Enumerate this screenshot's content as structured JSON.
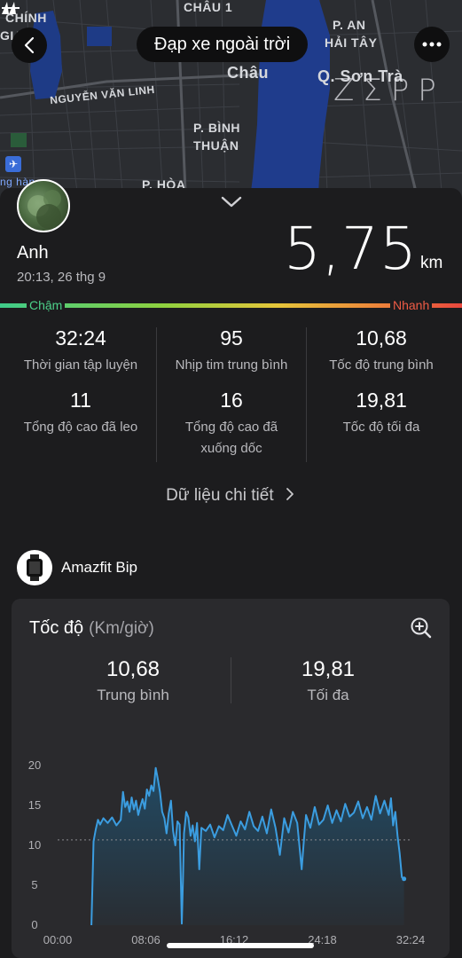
{
  "map": {
    "labels": {
      "chinh": "CHÍNH",
      "gia": "GIA",
      "chau1": "CHÂU 1",
      "p_an": "P. AN",
      "hai_tay": "HẢI TÂY",
      "chau": "Châu",
      "son_tra": "Q. Sơn Trà",
      "nguyen_van_linh": "NGUYỄN VĂN LINH",
      "p_binh": "P. BÌNH",
      "thuan": "THUẬN",
      "p_hoa": "P. HÒA",
      "ng_han": "ng hàn"
    },
    "watermark": "ZΣPP"
  },
  "header": {
    "title": "Đạp xe ngoài trời",
    "back_icon": "chevron-left-icon",
    "more_icon": "more-dots-icon"
  },
  "workout": {
    "user_name": "Anh",
    "datetime": "20:13, 26 thg 9",
    "distance": "5,75",
    "distance_unit": "km",
    "slow_label": "Chậm",
    "fast_label": "Nhanh"
  },
  "stats": [
    {
      "value": "32:24",
      "label": "Thời gian tập luyện"
    },
    {
      "value": "95",
      "label": "Nhịp tim trung bình"
    },
    {
      "value": "10,68",
      "label": "Tốc độ trung bình"
    },
    {
      "value": "11",
      "label": "Tổng độ cao đã leo"
    },
    {
      "value": "16",
      "label": "Tổng độ cao đã xuống dốc"
    },
    {
      "value": "19,81",
      "label": "Tốc độ tối đa"
    }
  ],
  "detail_link": "Dữ liệu chi tiết",
  "device": {
    "name": "Amazfit Bip"
  },
  "speed_card": {
    "title": "Tốc độ",
    "unit": "(Km/giờ)",
    "avg_value": "10,68",
    "avg_label": "Trung bình",
    "max_value": "19,81",
    "max_label": "Tối đa"
  },
  "colors": {
    "line": "#3b9de0",
    "fill_top": "#1f5576",
    "avg_line": "#8a8a8e"
  },
  "chart_data": {
    "type": "area",
    "title": "",
    "xlabel": "",
    "ylabel": "",
    "ylim": [
      0,
      20
    ],
    "yticks": [
      "0",
      "5",
      "10",
      "15",
      "20"
    ],
    "xticks": [
      "00:00",
      "08:06",
      "16:12",
      "24:18",
      "32:24"
    ],
    "average": 10.68,
    "series": [
      {
        "x_min": [
          3.1,
          3.3,
          3.5,
          3.7,
          3.9,
          4.2,
          4.6,
          5.0,
          5.4,
          5.8,
          6.0,
          6.2,
          6.4,
          6.6,
          6.8,
          7.0,
          7.2,
          7.4,
          7.6,
          7.8,
          8.0,
          8.2,
          8.4,
          8.6,
          8.8,
          9.0,
          9.2,
          9.4,
          9.6,
          9.8,
          10.0,
          10.2,
          10.4,
          10.6,
          10.8,
          11.0,
          11.2,
          11.4,
          11.5,
          11.6,
          11.8,
          12.0,
          12.2,
          12.4,
          12.6,
          12.8,
          13.0,
          13.2,
          13.6,
          14.0,
          14.4,
          14.8,
          15.2,
          15.6,
          16.0,
          16.4,
          16.8,
          17.2,
          17.6,
          18.0,
          18.4,
          18.8,
          19.2,
          19.6,
          20.0,
          20.4,
          20.8,
          21.2,
          21.6,
          22.0,
          22.4,
          22.6,
          22.8,
          23.2,
          23.6,
          24.0,
          24.4,
          24.8,
          25.2,
          25.6,
          26.0,
          26.4,
          26.8,
          27.2,
          27.6,
          28.0,
          28.4,
          28.8,
          29.2,
          29.6,
          30.0,
          30.4,
          30.6,
          30.8,
          31.0,
          31.2,
          31.4,
          31.6,
          31.8
        ],
        "values": [
          0.0,
          10.5,
          12.0,
          13.2,
          12.6,
          13.4,
          12.8,
          13.5,
          12.5,
          13.2,
          16.7,
          14.8,
          15.5,
          14.2,
          16.0,
          14.5,
          15.6,
          13.8,
          14.9,
          15.8,
          14.6,
          17.0,
          16.2,
          17.5,
          16.8,
          19.7,
          18.3,
          16.6,
          14.2,
          13.4,
          11.5,
          14.0,
          15.6,
          11.8,
          10.0,
          13.0,
          12.6,
          0.2,
          5.5,
          11.5,
          14.2,
          13.5,
          11.2,
          12.5,
          10.5,
          12.8,
          7.0,
          12.2,
          11.8,
          12.6,
          11.0,
          12.4,
          11.9,
          13.8,
          12.5,
          11.2,
          13.0,
          12.0,
          14.2,
          12.4,
          11.8,
          13.6,
          11.5,
          14.5,
          12.2,
          8.8,
          13.4,
          11.6,
          14.2,
          12.8,
          7.0,
          10.5,
          13.8,
          12.2,
          14.8,
          12.6,
          13.2,
          15.0,
          12.8,
          14.4,
          13.0,
          15.2,
          13.6,
          14.1,
          15.5,
          13.4,
          14.8,
          13.2,
          16.2,
          14.0,
          15.6,
          13.8,
          15.9,
          12.5,
          14.2,
          11.2,
          9.0,
          6.0,
          5.8
        ]
      }
    ]
  }
}
